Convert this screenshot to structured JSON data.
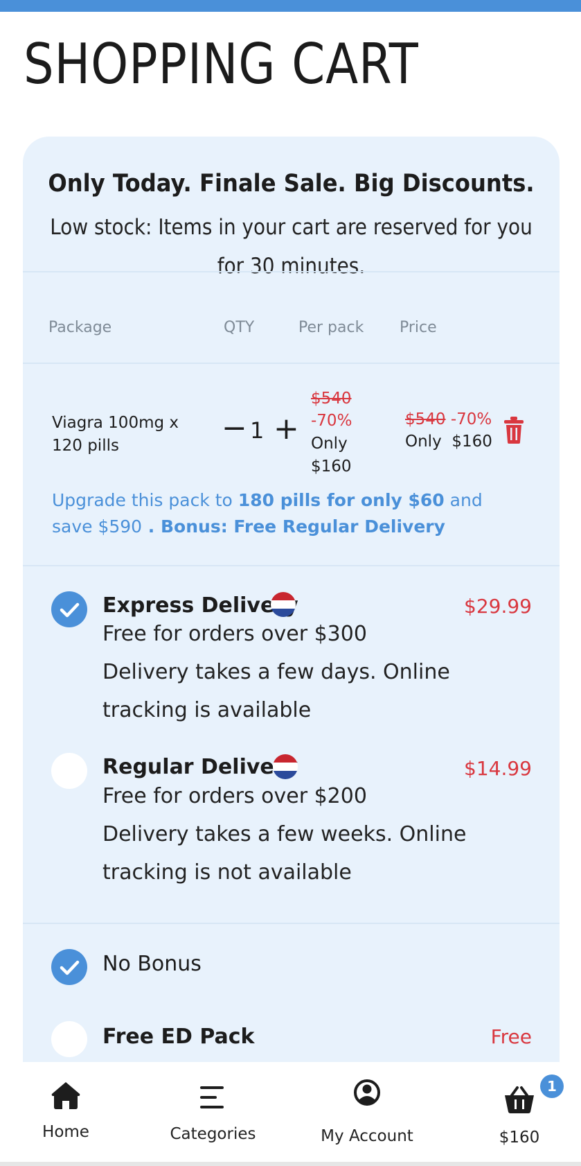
{
  "page": {
    "title": "SHOPPING CART"
  },
  "promo": {
    "headline": "Only Today. Finale Sale. Big Discounts.",
    "notice": "Low stock: Items in your cart are reserved for you for 30 minutes."
  },
  "table": {
    "headers": {
      "package": "Package",
      "qty": "QTY",
      "per_pack": "Per pack",
      "price": "Price"
    }
  },
  "cart_item": {
    "name": "Viagra 100mg x 120 pills",
    "qty": "1",
    "minus": "−",
    "plus": "+",
    "per_pack_old": "$540",
    "per_pack_discount": "-70%",
    "per_pack_only": "Only",
    "per_pack_new": "$160",
    "price_old": "$540",
    "price_discount": "-70%",
    "price_only": "Only",
    "price_new": "$160"
  },
  "upsell": {
    "prefix": "Upgrade this pack to ",
    "offer": "180 pills for only $60",
    "middle": " and save ",
    "save": "$590",
    "bonus": " . Bonus: Free Regular Delivery"
  },
  "delivery": [
    {
      "title": "Express Delivery",
      "price": "$29.99",
      "line1": "Free for orders over $300",
      "line2": "Delivery takes a few days. Online tracking is available",
      "selected": true
    },
    {
      "title": "Regular Delivery",
      "price": "$14.99",
      "line1": "Free for orders over $200",
      "line2": "Delivery takes a few weeks. Online tracking is not available",
      "selected": false
    }
  ],
  "bonus": [
    {
      "title": "No Bonus",
      "price": "",
      "selected": true
    },
    {
      "title": "Free ED Pack",
      "price": "Free",
      "selected": false
    }
  ],
  "nav": {
    "home": "Home",
    "categories": "Categories",
    "account": "My Account",
    "cart_total": "$160",
    "cart_count": "1"
  },
  "colors": {
    "accent": "#4a90d9",
    "sale_red": "#d9373f",
    "card_bg": "#e8f2fc"
  }
}
